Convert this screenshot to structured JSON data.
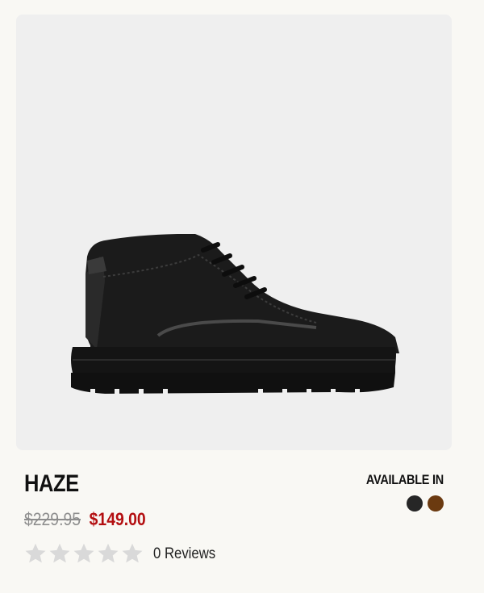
{
  "product": {
    "image_alt": "Black suede chukka boot",
    "name": "HAZE",
    "price_original": "$229.95",
    "price_sale": "$149.00",
    "rating_stars_filled": 0,
    "rating_stars_total": 5,
    "reviews_label": "0 Reviews",
    "available_label": "AVAILABLE IN",
    "colors": [
      {
        "name": "black",
        "hex": "#262626"
      },
      {
        "name": "brown",
        "hex": "#6b3a10"
      }
    ]
  },
  "theme": {
    "background": "#f9f8f4",
    "image_background": "#efefef",
    "sale_price_color": "#b30e10",
    "original_price_color": "#8d8d8d",
    "star_empty_color": "#d9d9d9"
  }
}
